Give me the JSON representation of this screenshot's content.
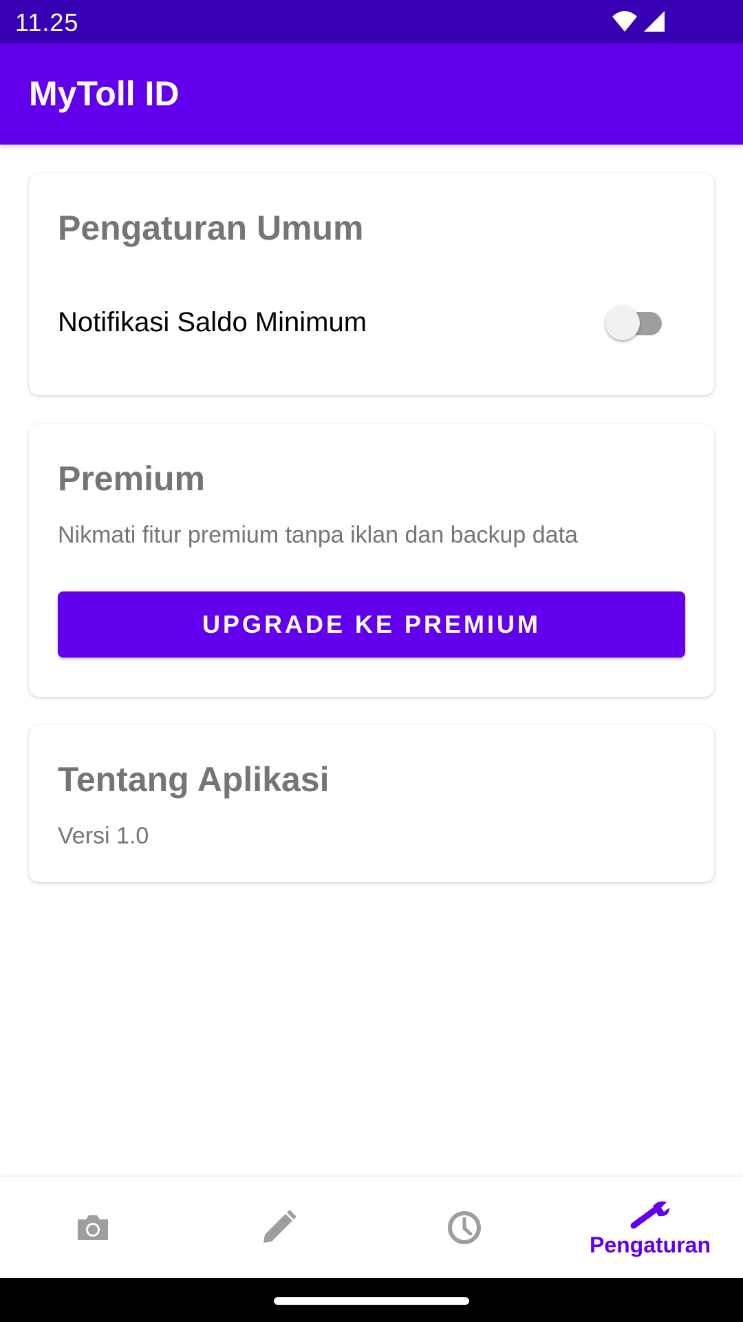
{
  "status_bar": {
    "time": "11.25",
    "icons": [
      "wifi-icon",
      "signal-icon"
    ]
  },
  "app_bar": {
    "title": "MyToll ID",
    "color": "#6200EE"
  },
  "general_settings": {
    "title": "Pengaturan Umum",
    "low_balance_label": "Notifikasi Saldo Minimum",
    "low_balance_enabled": false
  },
  "premium": {
    "title": "Premium",
    "description": "Nikmati fitur premium tanpa iklan dan backup data",
    "button_label": "UPGRADE KE PREMIUM"
  },
  "about": {
    "title": "Tentang Aplikasi",
    "version": "Versi 1.0"
  },
  "bottom_nav": {
    "items": [
      {
        "icon": "camera-icon",
        "label": "",
        "active": false
      },
      {
        "icon": "pencil-icon",
        "label": "",
        "active": false
      },
      {
        "icon": "clock-icon",
        "label": "",
        "active": false
      },
      {
        "icon": "wrench-icon",
        "label": "Pengaturan",
        "active": true
      }
    ],
    "active_color": "#6200EE",
    "inactive_color": "#9E9E9E"
  }
}
